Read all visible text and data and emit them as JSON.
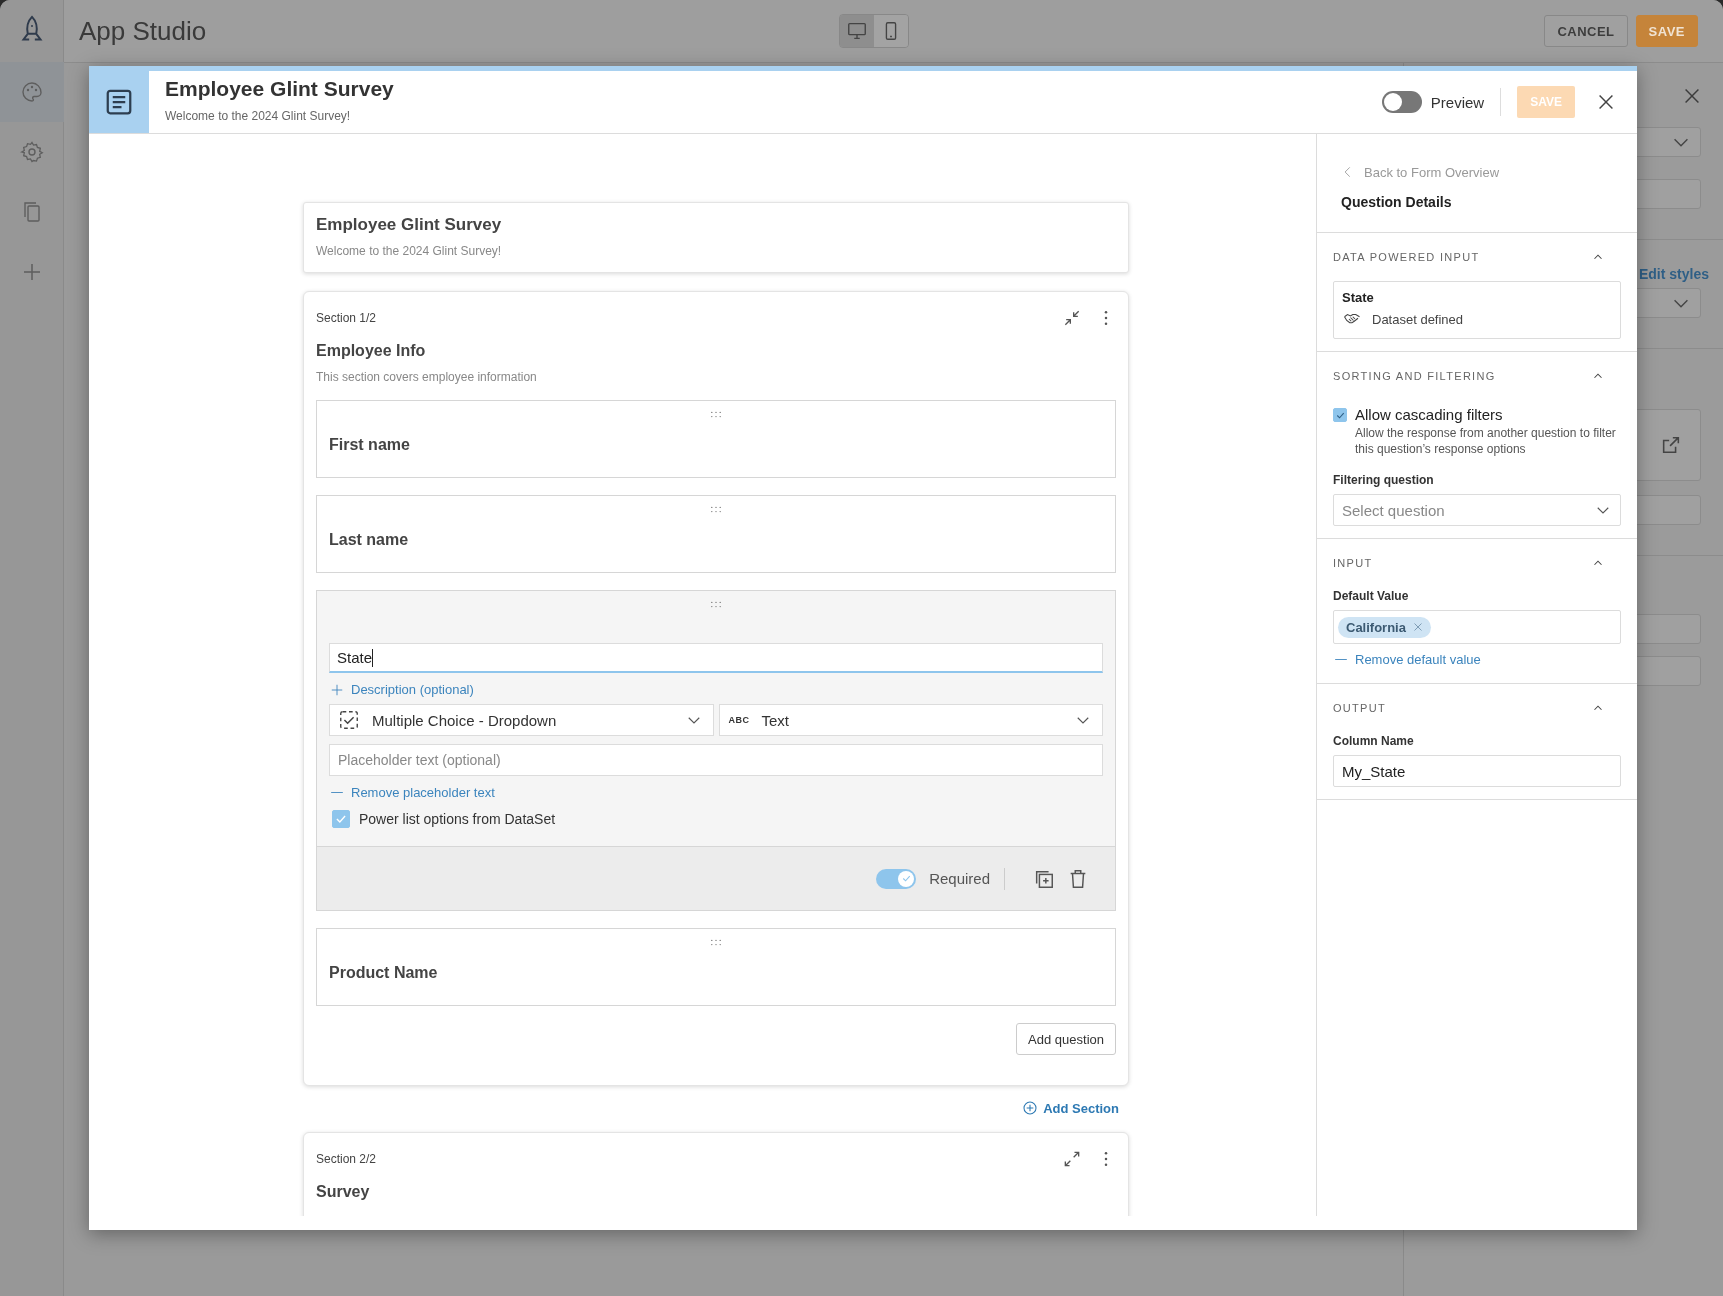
{
  "app": {
    "title": "App Studio",
    "view_modes": [
      {
        "kind": "desktop",
        "selected": true
      },
      {
        "kind": "mobile",
        "selected": false
      }
    ],
    "buttons": [
      {
        "label": "CANCEL",
        "kind": "secondary"
      },
      {
        "label": "SAVE",
        "kind": "primary"
      }
    ],
    "rail": [
      {
        "kind": "palette",
        "selected": true
      },
      {
        "kind": "gear",
        "selected": false
      },
      {
        "kind": "copy",
        "selected": false
      },
      {
        "kind": "plus",
        "selected": false
      }
    ],
    "side_link": "Edit styles"
  },
  "dialog": {
    "title": "Employee Glint Survey",
    "subtitle": "Welcome to the 2024 Glint Survey!",
    "preview": {
      "label": "Preview",
      "on": false
    },
    "save": {
      "label": "SAVE",
      "disabled": true
    }
  },
  "form": {
    "title": "Employee Glint Survey",
    "subtitle": "Welcome to the 2024 Glint Survey!",
    "sections": [
      {
        "label": "Section 1/2",
        "title": "Employee Info",
        "description": "This section covers employee information",
        "expanded": true,
        "questions": [
          {
            "label": "First name",
            "selected": false
          },
          {
            "label": "Last name",
            "selected": false
          },
          {
            "label": "State",
            "selected": true,
            "editor": {
              "description_link": "Description (optional)",
              "type": {
                "label": "Multiple Choice - Dropdown"
              },
              "data_type": {
                "badge": "ABC",
                "label": "Text"
              },
              "placeholder": "Placeholder text (optional)",
              "remove_link": "Remove placeholder text",
              "power_list": {
                "label": "Power list options from DataSet",
                "checked": true
              },
              "required": {
                "label": "Required",
                "on": true
              }
            }
          },
          {
            "label": "Product Name",
            "selected": false
          }
        ],
        "add_question": "Add question"
      },
      {
        "label": "Section 2/2",
        "title": "Survey",
        "expanded": false
      }
    ],
    "add_section": "Add Section"
  },
  "details": {
    "back": "Back to Form Overview",
    "title": "Question Details",
    "panels": [
      {
        "kind": "dataset",
        "title": "DATA POWERED INPUT",
        "expanded": true,
        "name": "State",
        "source": "Dataset defined"
      },
      {
        "kind": "filtering",
        "title": "SORTING AND FILTERING",
        "expanded": true,
        "checkbox": {
          "label": "Allow cascading filters",
          "help": "Allow the response from another question to filter this question’s response options",
          "checked": true
        },
        "field_label": "Filtering question",
        "placeholder": "Select question"
      },
      {
        "kind": "input",
        "title": "INPUT",
        "expanded": true,
        "field_label": "Default Value",
        "chips": [
          "California"
        ],
        "remove_link": "Remove default value"
      },
      {
        "kind": "output",
        "title": "OUTPUT",
        "expanded": true,
        "field_label": "Column Name",
        "value": "My_State"
      }
    ]
  }
}
